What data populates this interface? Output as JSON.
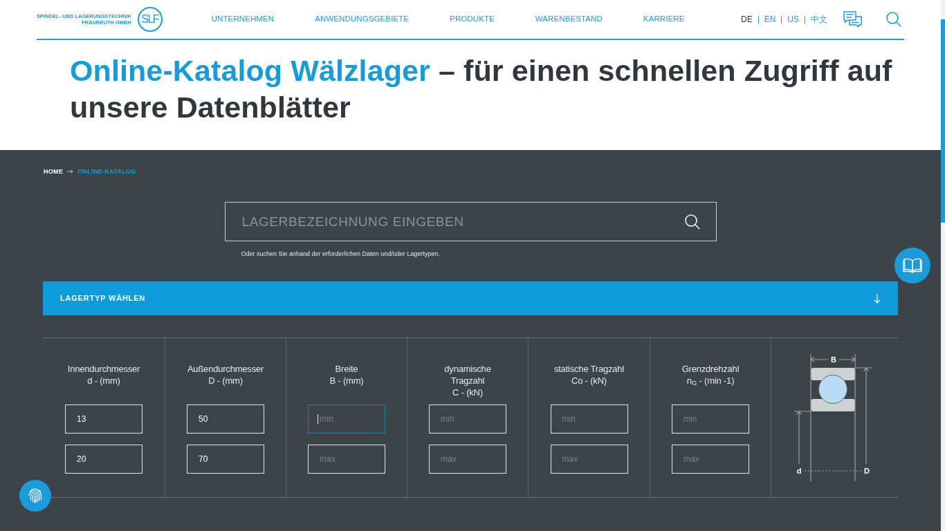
{
  "header": {
    "logo": {
      "line_1": "SPINDEL- UND LAGERUNGSTECHNIK",
      "line_2": "FRAUREUTH GMBH",
      "mark": "SLF"
    },
    "nav": [
      "UNTERNEHMEN",
      "ANWENDUNGSGEBIETE",
      "PRODUKTE",
      "WARENBESTAND",
      "KARRIERE"
    ],
    "languages": [
      {
        "label": "DE",
        "selected": true
      },
      {
        "label": "EN",
        "selected": false
      },
      {
        "label": "US",
        "selected": false
      },
      {
        "label": "中文",
        "selected": false
      }
    ]
  },
  "title": {
    "highlight": "Online-Katalog Wälzlager",
    "rest": "– für einen schnellen Zugriff auf unsere Datenblätter"
  },
  "breadcrumb": [
    {
      "label": "HOME",
      "current": false
    },
    {
      "label": "ONLINE-KATALOG",
      "current": true
    }
  ],
  "search": {
    "placeholder": "LAGERBEZEICHNUNG EINGEBEN",
    "hint": "Oder suchen Sie anhand der erforderlichen Daten und/oder Lagertypen."
  },
  "bearing_type": {
    "label": "LAGERTYP WÄHLEN",
    "expanded": false
  },
  "filters": [
    {
      "heading": [
        "Innendurchmesser",
        "d - (mm)"
      ],
      "min": {
        "value": "13",
        "focused": false
      },
      "max": {
        "value": "20",
        "focused": false
      }
    },
    {
      "heading": [
        "Außendurchmesser",
        "D - (mm)"
      ],
      "min": {
        "value": "50",
        "focused": false
      },
      "max": {
        "value": "70",
        "focused": false
      }
    },
    {
      "heading": [
        "Breite",
        "B - (mm)"
      ],
      "min": {
        "placeholder": "min",
        "focused": true
      },
      "max": {
        "placeholder": "max",
        "focused": false
      }
    },
    {
      "heading": [
        "dynamische",
        "Tragzahl",
        "C - (kN)"
      ],
      "min": {
        "placeholder": "min",
        "focused": false
      },
      "max": {
        "placeholder": "max",
        "focused": false
      }
    },
    {
      "heading": [
        "statische Tragzahl",
        "Co - (kN)"
      ],
      "min": {
        "placeholder": "min",
        "focused": false
      },
      "max": {
        "placeholder": "max",
        "focused": false
      }
    },
    {
      "heading": [
        "Grenzdrehzahl",
        "n$_{G}$ - (min -1)"
      ],
      "min": {
        "placeholder": "min",
        "focused": false
      },
      "max": {
        "placeholder": "max",
        "focused": false
      }
    }
  ],
  "diagram": {
    "width": "B",
    "inner_diameter": "d",
    "outer_diameter": "D"
  }
}
